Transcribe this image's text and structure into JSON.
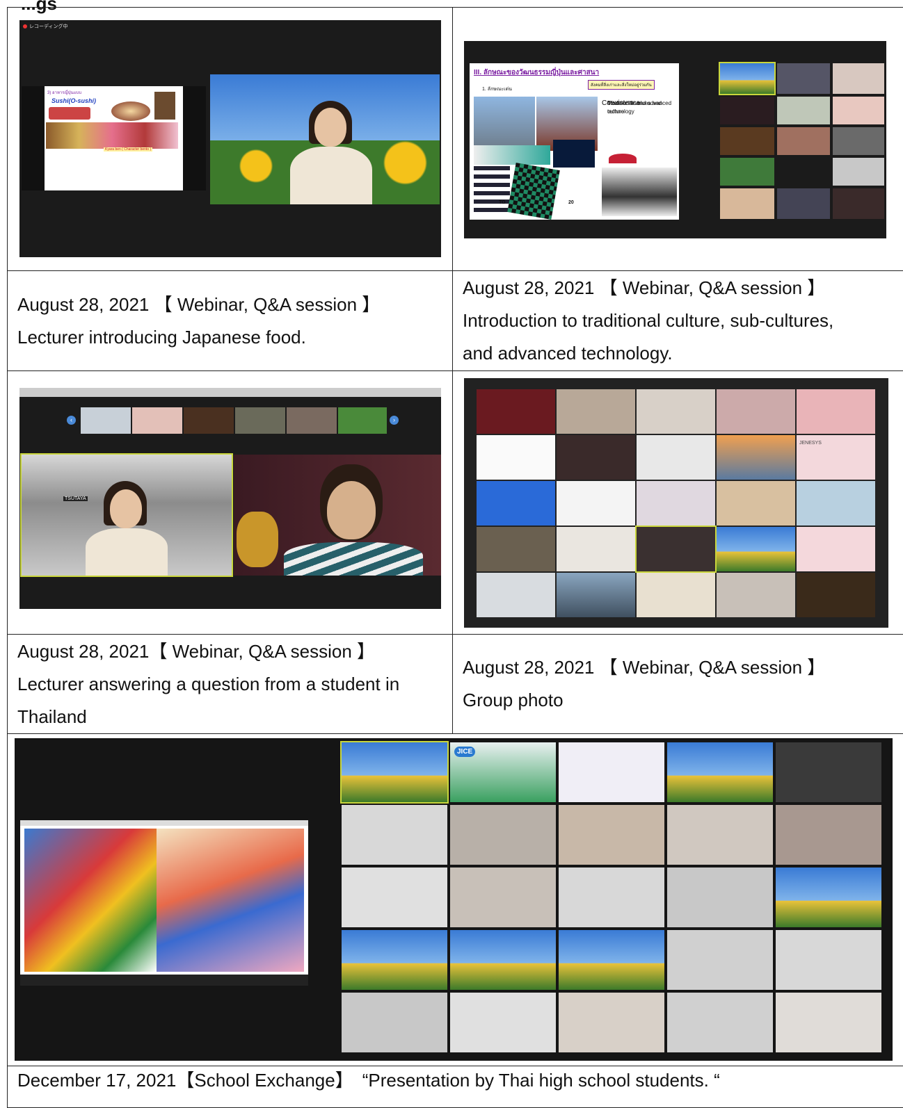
{
  "page_top_label": "...gs",
  "rows": [
    {
      "left_caption": {
        "line1": "August 28, 2021 【 Webinar, Q&A session 】",
        "line2": "Lecturer introducing Japanese food."
      },
      "right_caption": {
        "line1": "August 28, 2021 【 Webinar, Q&A session 】",
        "line2": "Introduction to traditional culture, sub-cultures,",
        "line3": "and advanced technology."
      },
      "left_image": {
        "recording_label": "レコーディング中",
        "slide_heading": "3) อาหารญี่ปุ่นแบบ",
        "slide_title": "Sushi(O-sushi)",
        "slide_caption": "Kyara ben ( Character bento )"
      },
      "right_image": {
        "slide_heading": "III. ลักษณะของวัฒนธรรมญี่ปุ่นและศาสนา",
        "slide_sub": "1. ลักษณะเด่น",
        "slide_box": "สังคมที่สิ่งเก่าและสิ่งใหม่อยู่ร่วมกัน",
        "bullets": [
          "Coexistence",
          "Traditional values and culture",
          "Modern life and advanced technology"
        ],
        "logo_text": "TO",
        "year_text": "20"
      }
    },
    {
      "left_caption": {
        "line1": "August 28, 2021【 Webinar, Q&A session 】",
        "line2": "Lecturer answering a question from a student in",
        "line3": "Thailand"
      },
      "right_caption": {
        "line1": "August 28, 2021 【 Webinar, Q&A session 】",
        "line2": "Group photo"
      },
      "left_image": {
        "store_sign": "TSUTAYA",
        "nav_prev": "‹",
        "nav_next": "›"
      },
      "right_image": {
        "tile_label": "JENESYS"
      }
    },
    {
      "bottom_caption": "December 17, 2021【School Exchange】　“Presentation by Thai high school students. “",
      "image": {
        "shared_slide_text": "...",
        "jice_logo": "JICE"
      }
    }
  ],
  "colors": {
    "border": "#222222",
    "zoom_bg": "#1b1b1b",
    "active_speaker": "#c9d63b",
    "slide_title_purple": "#7b1fa2",
    "sushi_title_blue": "#1f3fbf"
  }
}
